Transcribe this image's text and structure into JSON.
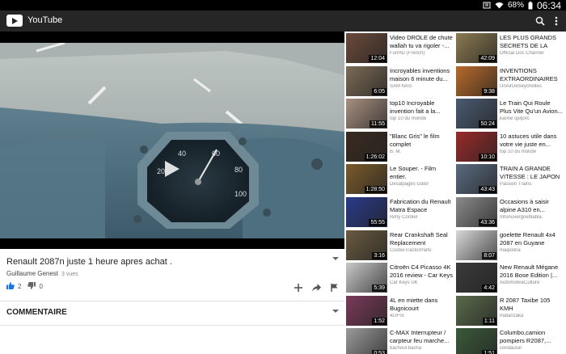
{
  "status_bar": {
    "battery": "68%",
    "time": "06:34"
  },
  "app": {
    "title": "YouTube"
  },
  "video": {
    "title": "Renault 2087n juste 1 heure apres achat .",
    "channel": "Guillaume Genest",
    "views": "3 vues",
    "likes": "2",
    "dislikes": "0"
  },
  "comments": {
    "header": "COMMENTAIRE"
  },
  "related": [
    {
      "title": "Video DROLE de chute wallah tu va rigoler -...",
      "channel": "FunHD (French)",
      "duration": "12:04",
      "color": "#6a4a3a"
    },
    {
      "title": "LES PLUS GRANDS SECRETS DE LA NASA",
      "channel": "Official Doc Channel",
      "duration": "42:09",
      "color": "#8a7a50"
    },
    {
      "title": "Incroyables inventions maison 6 minute du...",
      "channel": "SAM NAS",
      "duration": "6:05",
      "color": "#7a6a55"
    },
    {
      "title": "INVENTIONS EXTRAORDINAIRES",
      "channel": "UnAirDeSeychelles",
      "duration": "9:38",
      "color": "#b86a2a"
    },
    {
      "title": "top10 Incroyable invention fait a la...",
      "channel": "top 10 du monde",
      "duration": "11:55",
      "color": "#a89080"
    },
    {
      "title": "Le Train Qui Roule Plus Vite Qu'un Avion...",
      "channel": "karine spiljorc",
      "duration": "50:24",
      "color": "#4a5a70"
    },
    {
      "title": "\"Blanc Gris\" le film complet",
      "channel": "B. M.",
      "duration": "1:26:02",
      "color": "#3a2a20"
    },
    {
      "title": "10 astuces utile dans votre vie juste en...",
      "channel": "top 10 du monde",
      "duration": "10:10",
      "color": "#9a2a2a"
    },
    {
      "title": "Le Souper. - Film entier.",
      "channel": "Desalpages Gator",
      "duration": "1:28:50",
      "color": "#7a5a2a"
    },
    {
      "title": "TRAIN A GRANDE VITESSE : LE JAPON",
      "channel": "Passion Trains",
      "duration": "43:43",
      "color": "#5a6a80"
    },
    {
      "title": "Fabrication du Renault Matra Espace jusqu'e...",
      "channel": "rémy Cordier",
      "duration": "55:55",
      "color": "#2a3a8a"
    },
    {
      "title": "Occasions à saisir alpine A310 en...",
      "channel": "InfoAuvergneblabla.",
      "duration": "43:36",
      "color": "#8a8a8a"
    },
    {
      "title": "Rear Crankshaft Seal Replacement",
      "channel": "CostexTractorParts",
      "duration": "3:16",
      "color": "#6a5a40"
    },
    {
      "title": "goelette Renault 4x4 2087 en Guyane",
      "channel": "maipolina",
      "duration": "8:07",
      "color": "#d8d8d8"
    },
    {
      "title": "Citroën C4 Picasso 4K 2016 review - Car Keys",
      "channel": "Car Keys UK",
      "duration": "5:39",
      "color": "#c8c8c8"
    },
    {
      "title": "New Renault Mégane 2016 Bose Edition |...",
      "channel": "AutomotiveCulture",
      "duration": "4:42",
      "color": "#3a3a3a"
    },
    {
      "title": "4L en miette dans Bugnicourt",
      "channel": "4LIFSI",
      "duration": "1:52",
      "color": "#7a3a5a"
    },
    {
      "title": "R 2087 Taxibe 105 KMH",
      "channel": "matanzaka",
      "duration": "1:11",
      "color": "#5a6a4a"
    },
    {
      "title": "C-MAX Interrupteur / carpteur feu marche...",
      "channel": "bachoul bacha",
      "duration": "0:53",
      "color": "#9a9a9a"
    },
    {
      "title": "Columbo,camion pompiers R2087,...",
      "channel": "condausin",
      "duration": "1:51",
      "color": "#3a5a3a"
    }
  ]
}
